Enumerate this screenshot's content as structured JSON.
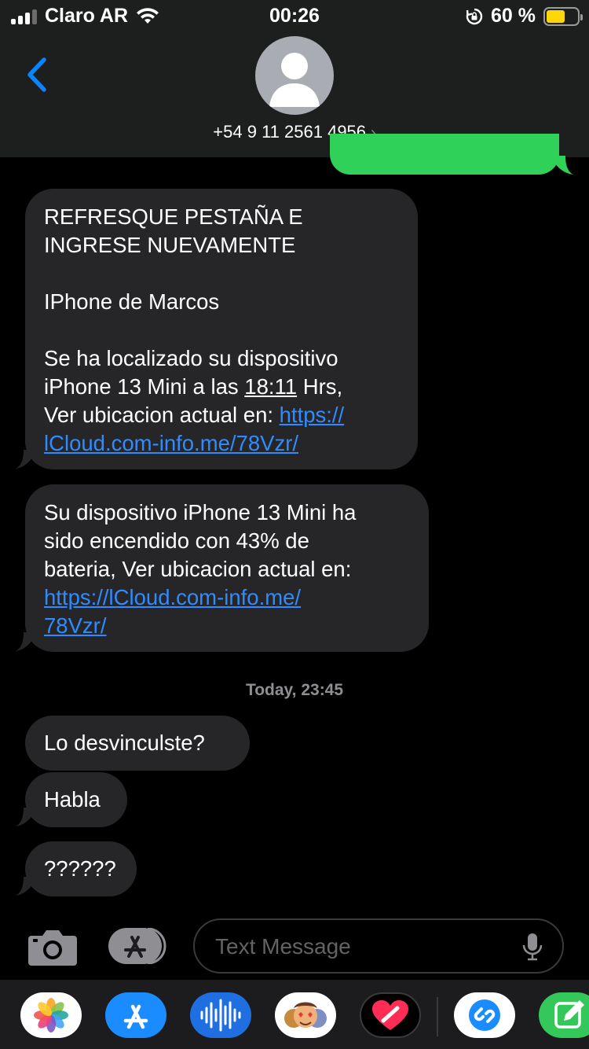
{
  "status_bar": {
    "carrier": "Claro AR",
    "time": "00:26",
    "battery_percent": "60 %",
    "battery_level": 0.6
  },
  "header": {
    "contact": "+54 9 11 2561 4956",
    "chevron": "›"
  },
  "messages": {
    "m1": {
      "line1": "REFRESQUE PESTAÑA E",
      "line2": "INGRESE NUEVAMENTE",
      "line3": "IPhone de Marcos",
      "line4": "Se ha localizado su dispositivo",
      "line5a": "iPhone 13 Mini a las ",
      "line5time": "18:11",
      "line5b": " Hrs,",
      "line6text": "Ver ubicacion actual en: ",
      "link_part1": "https://",
      "link_part2": "lCloud.com-info.me/78Vzr/"
    },
    "m2": {
      "line1": "Su dispositivo iPhone 13 Mini ha",
      "line2": "sido encendido con 43% de",
      "line3": "bateria, Ver ubicacion actual en:",
      "link_part1": "https://lCloud.com-info.me/",
      "link_part2": "78Vzr/"
    },
    "timestamp": "Today, 23:45",
    "m3": "Lo desvinculste?",
    "m4": "Habla",
    "m5": "??????"
  },
  "input": {
    "placeholder": "Text Message"
  },
  "colors": {
    "sent_bubble": "#30d158",
    "received_bubble": "#262629",
    "link": "#2f8cff",
    "accent": "#0a84ff"
  },
  "icons": [
    "back-chevron-icon",
    "avatar-icon",
    "camera-icon",
    "appstore-icon",
    "mic-icon",
    "photos-app-icon",
    "app-store-app-icon",
    "audio-app-icon",
    "memoji-app-icon",
    "fitness-app-icon",
    "shazam-app-icon",
    "compose-app-icon"
  ]
}
